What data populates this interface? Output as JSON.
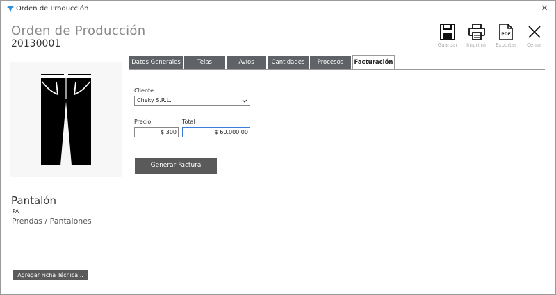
{
  "window": {
    "title": "Orden de Producción",
    "close_glyph": "✕"
  },
  "header": {
    "title": "Orden de Producción",
    "order_number": "20130001"
  },
  "toolbar": {
    "save_label": "Guardar",
    "print_label": "Imprimir",
    "export_label": "Exportar",
    "close_label": "Cerrar",
    "pdf_text": "PDF"
  },
  "product": {
    "name": "Pantalón",
    "code": "PA",
    "category": "Prendas / Pantalones",
    "image_icon": "pants-icon"
  },
  "ficha_button": "Agregar Ficha Técnica...",
  "tabs": [
    {
      "label": "Datos Generales"
    },
    {
      "label": "Telas"
    },
    {
      "label": "Avíos"
    },
    {
      "label": "Cantidades"
    },
    {
      "label": "Procesos"
    },
    {
      "label": "Facturación",
      "active": true
    }
  ],
  "billing": {
    "client_label": "Cliente",
    "client_value": "Cheky S.R.L.",
    "price_label": "Precio",
    "price_value": "$ 300",
    "total_label": "Total",
    "total_value": "$ 60.000,00",
    "generate_button": "Generar Factura"
  },
  "colors": {
    "accent": "#3b7dd8",
    "button": "#5a5a5a",
    "tab": "#5f6266",
    "app_icon": "#2f8fd8"
  }
}
